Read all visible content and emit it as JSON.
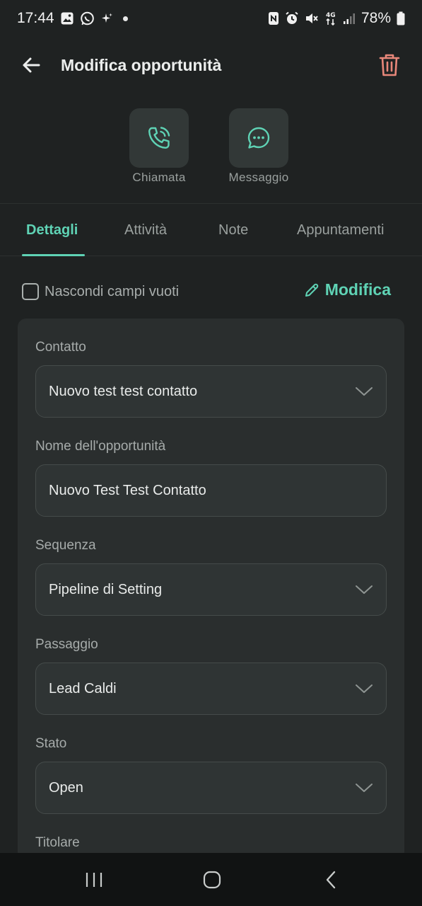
{
  "status_bar": {
    "time": "17:44",
    "battery": "78%",
    "left_icons": [
      "gallery-icon",
      "whatsapp-icon",
      "sparkle-icon",
      "dot-icon"
    ],
    "right_icons": [
      "nfc-icon",
      "alarm-icon",
      "mute-icon",
      "4g-data-icon",
      "signal-icon",
      "battery-icon"
    ]
  },
  "app_bar": {
    "title": "Modifica opportunità",
    "trash_color": "#e8877a"
  },
  "quick_actions": [
    {
      "label": "Chiamata",
      "icon": "phone-call-icon"
    },
    {
      "label": "Messaggio",
      "icon": "chat-bubble-icon"
    }
  ],
  "tabs": [
    {
      "label": "Dettagli",
      "active": true
    },
    {
      "label": "Attività",
      "active": false
    },
    {
      "label": "Note",
      "active": false
    },
    {
      "label": "Appuntamenti",
      "active": false
    }
  ],
  "options": {
    "hide_empty_label": "Nascondi campi vuoti",
    "hide_empty_checked": false,
    "edit_label": "Modifica"
  },
  "form": {
    "fields": [
      {
        "label": "Contatto",
        "value": "Nuovo test test contatto",
        "type": "dropdown"
      },
      {
        "label": "Nome dell'opportunità",
        "value": "Nuovo Test Test Contatto",
        "type": "text"
      },
      {
        "label": "Sequenza",
        "value": "Pipeline di Setting",
        "type": "dropdown"
      },
      {
        "label": "Passaggio",
        "value": "Lead Caldi",
        "type": "dropdown"
      },
      {
        "label": "Stato",
        "value": "Open",
        "type": "dropdown"
      },
      {
        "label": "Titolare",
        "value": "",
        "type": "dropdown"
      }
    ]
  },
  "colors": {
    "accent": "#5fd3b5",
    "background": "#1f2222",
    "card": "#2a2e2e",
    "danger": "#e8877a"
  }
}
